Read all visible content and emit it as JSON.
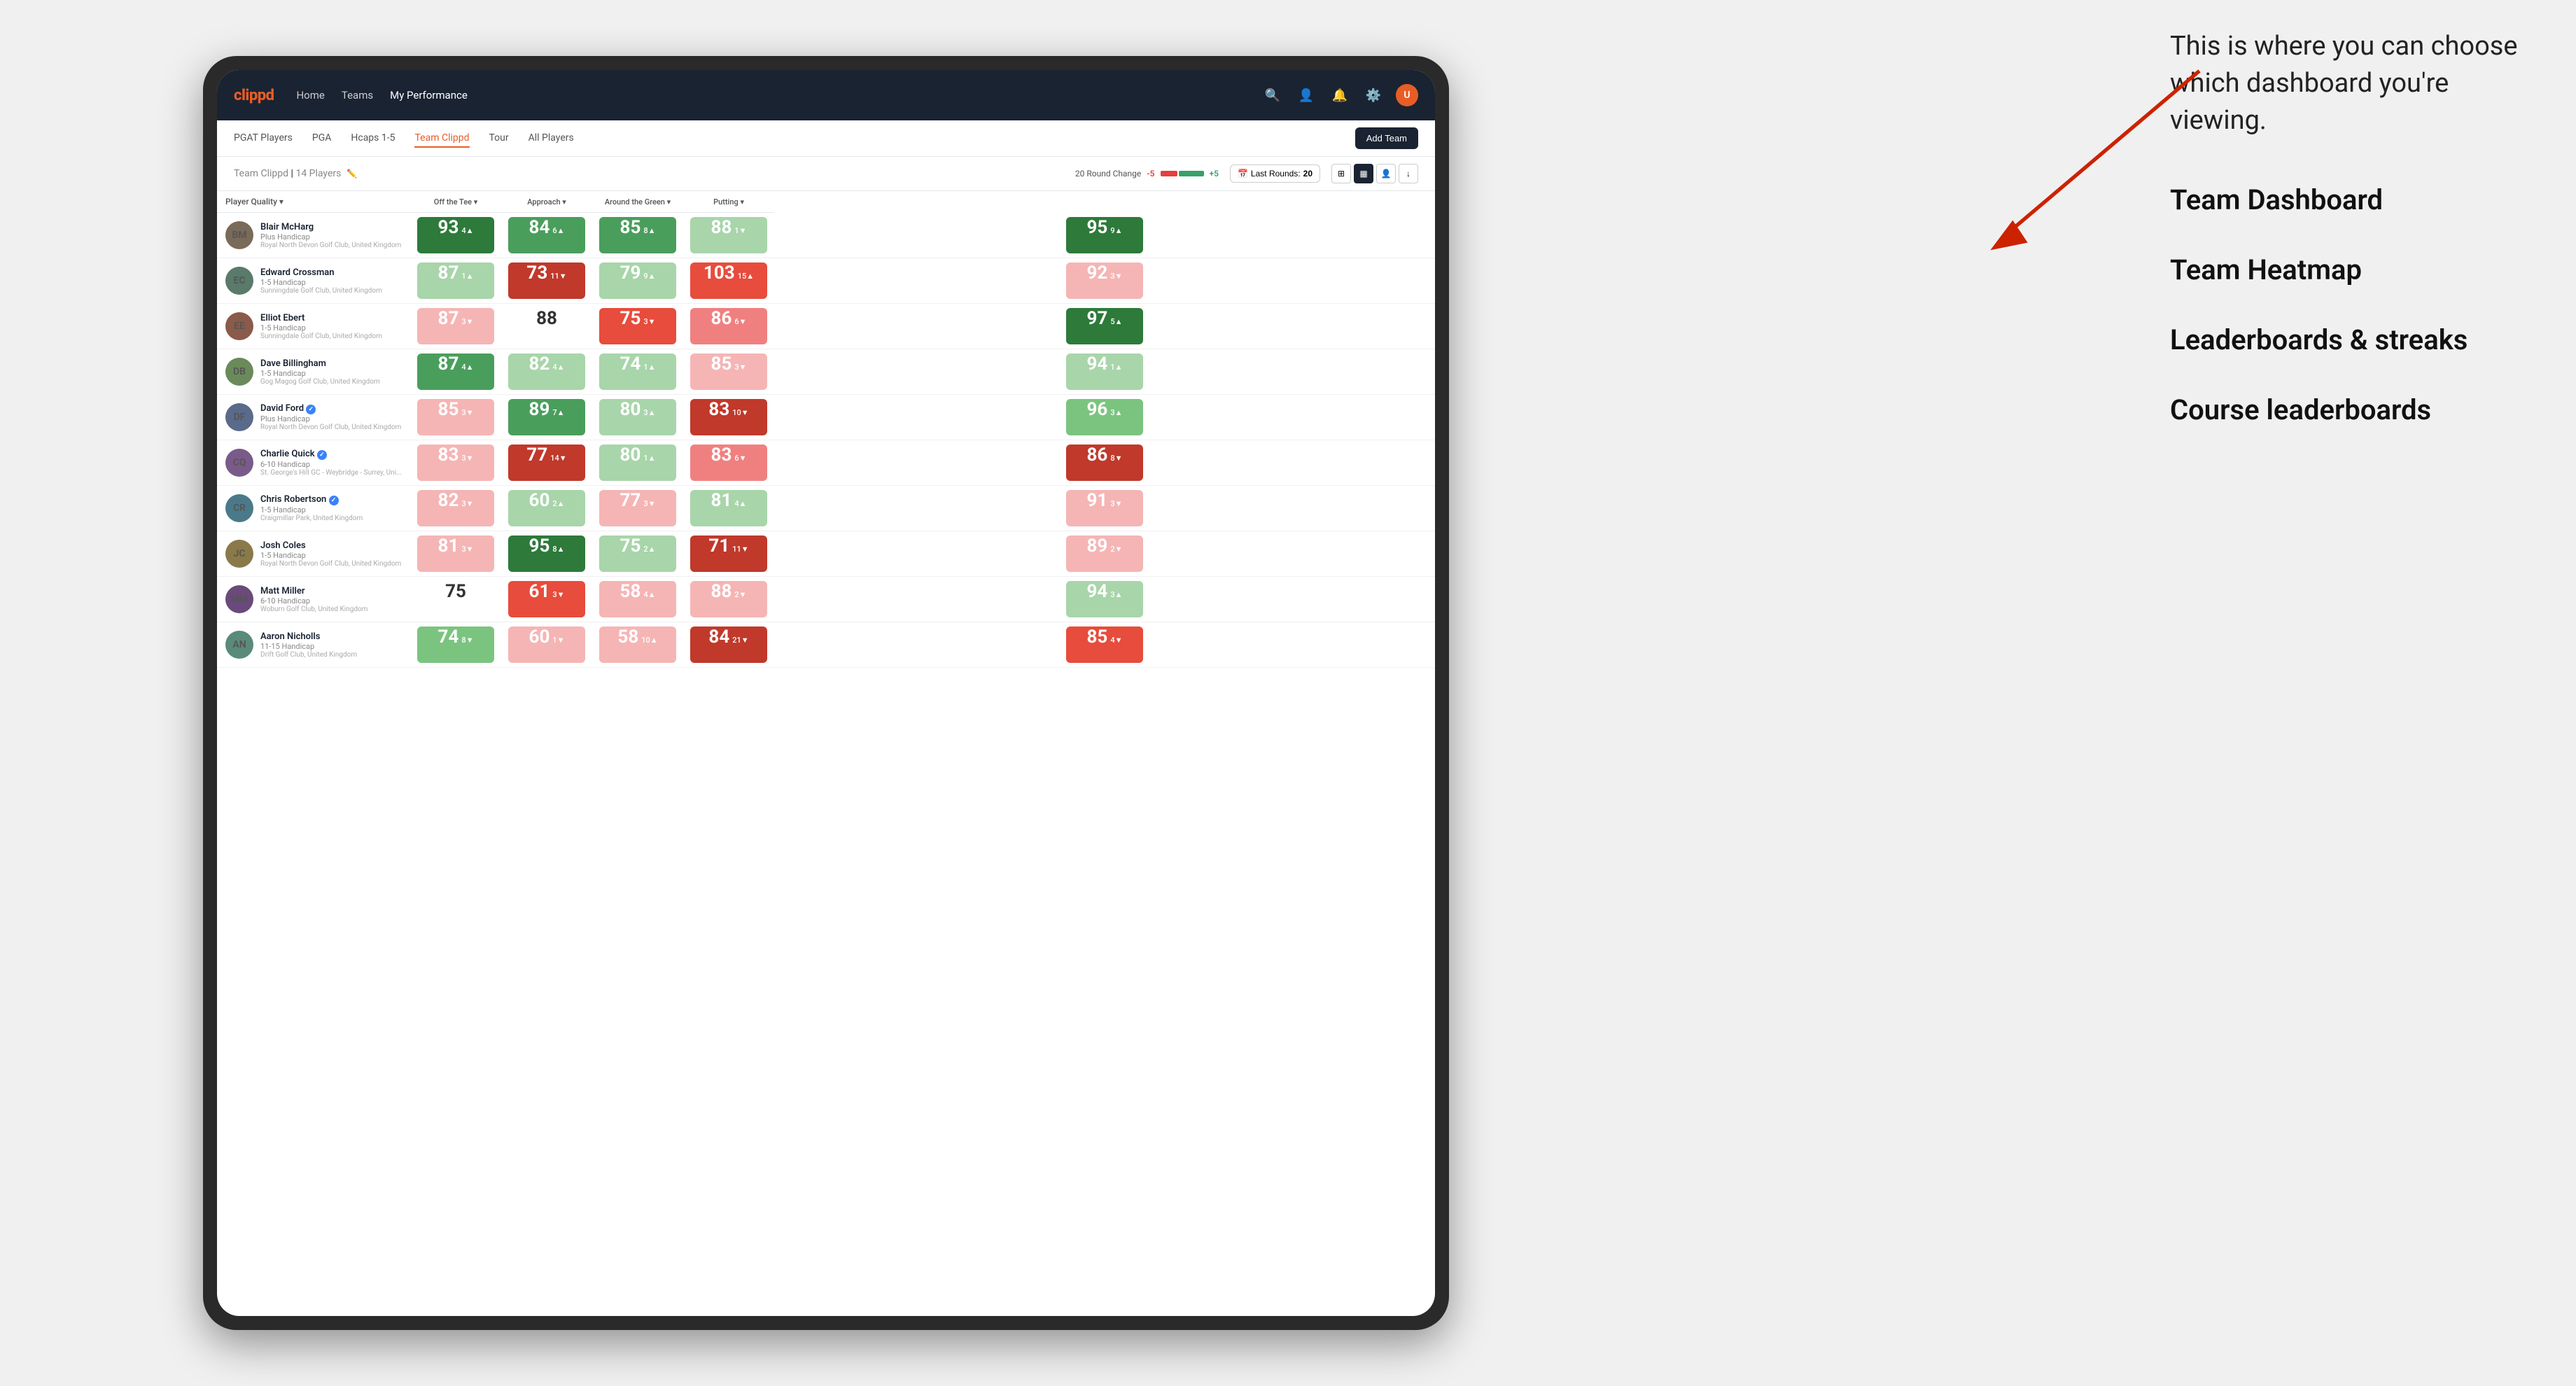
{
  "annotation": {
    "intro_text": "This is where you can choose which dashboard you're viewing.",
    "items": [
      {
        "label": "Team Dashboard",
        "active": true
      },
      {
        "label": "Team Heatmap",
        "active": false
      },
      {
        "label": "Leaderboards & streaks",
        "active": false
      },
      {
        "label": "Course leaderboards",
        "active": false
      }
    ]
  },
  "nav": {
    "logo": "clippd",
    "links": [
      "Home",
      "Teams",
      "My Performance"
    ],
    "active_link": "My Performance",
    "icons": [
      "search",
      "person",
      "bell",
      "settings",
      "avatar"
    ]
  },
  "sub_nav": {
    "links": [
      "PGAT Players",
      "PGA",
      "Hcaps 1-5",
      "Team Clippd",
      "Tour",
      "All Players"
    ],
    "active_link": "Team Clippd",
    "add_button": "Add Team"
  },
  "team_header": {
    "title": "Team Clippd",
    "count": "14 Players",
    "round_change_label": "20 Round Change",
    "minus": "-5",
    "plus": "+5",
    "last_rounds_label": "Last Rounds:",
    "last_rounds_value": "20"
  },
  "table": {
    "columns": {
      "player": "Player Quality ▾",
      "off_tee": "Off the Tee ▾",
      "approach": "Approach ▾",
      "around_green": "Around the Green ▾",
      "putting": "Putting ▾"
    },
    "players": [
      {
        "name": "Blair McHarg",
        "handicap": "Plus Handicap",
        "club": "Royal North Devon Golf Club, United Kingdom",
        "avatar_initials": "BM",
        "avatar_bg": "#7a6a5a",
        "scores": {
          "quality": {
            "value": 93,
            "change": 4,
            "dir": "up",
            "color": "bg-green-dark"
          },
          "off_tee": {
            "value": 84,
            "change": 6,
            "dir": "up",
            "color": "bg-green-med"
          },
          "approach": {
            "value": 85,
            "change": 8,
            "dir": "up",
            "color": "bg-green-med"
          },
          "around": {
            "value": 88,
            "change": 1,
            "dir": "down",
            "color": "bg-green-pale"
          },
          "putting": {
            "value": 95,
            "change": 9,
            "dir": "up",
            "color": "bg-green-dark"
          }
        }
      },
      {
        "name": "Edward Crossman",
        "handicap": "1-5 Handicap",
        "club": "Sunningdale Golf Club, United Kingdom",
        "avatar_initials": "EC",
        "avatar_bg": "#5a7a6a",
        "scores": {
          "quality": {
            "value": 87,
            "change": 1,
            "dir": "up",
            "color": "bg-green-pale"
          },
          "off_tee": {
            "value": 73,
            "change": 11,
            "dir": "down",
            "color": "bg-red-dark"
          },
          "approach": {
            "value": 79,
            "change": 9,
            "dir": "up",
            "color": "bg-green-pale"
          },
          "around": {
            "value": 103,
            "change": 15,
            "dir": "up",
            "color": "bg-red-med"
          },
          "putting": {
            "value": 92,
            "change": 3,
            "dir": "down",
            "color": "bg-red-pale"
          }
        }
      },
      {
        "name": "Elliot Ebert",
        "handicap": "1-5 Handicap",
        "club": "Sunningdale Golf Club, United Kingdom",
        "avatar_initials": "EE",
        "avatar_bg": "#8a5a4a",
        "scores": {
          "quality": {
            "value": 87,
            "change": 3,
            "dir": "down",
            "color": "bg-red-pale"
          },
          "off_tee": {
            "value": 88,
            "change": 0,
            "dir": null,
            "color": "bg-white"
          },
          "approach": {
            "value": 75,
            "change": 3,
            "dir": "down",
            "color": "bg-red-med"
          },
          "around": {
            "value": 86,
            "change": 6,
            "dir": "down",
            "color": "bg-red-light"
          },
          "putting": {
            "value": 97,
            "change": 5,
            "dir": "up",
            "color": "bg-green-dark"
          }
        }
      },
      {
        "name": "Dave Billingham",
        "handicap": "1-5 Handicap",
        "club": "Gog Magog Golf Club, United Kingdom",
        "avatar_initials": "DB",
        "avatar_bg": "#6a8a5a",
        "scores": {
          "quality": {
            "value": 87,
            "change": 4,
            "dir": "up",
            "color": "bg-green-med"
          },
          "off_tee": {
            "value": 82,
            "change": 4,
            "dir": "up",
            "color": "bg-green-pale"
          },
          "approach": {
            "value": 74,
            "change": 1,
            "dir": "up",
            "color": "bg-green-pale"
          },
          "around": {
            "value": 85,
            "change": 3,
            "dir": "down",
            "color": "bg-red-pale"
          },
          "putting": {
            "value": 94,
            "change": 1,
            "dir": "up",
            "color": "bg-green-pale"
          }
        }
      },
      {
        "name": "David Ford",
        "handicap": "Plus Handicap",
        "club": "Royal North Devon Golf Club, United Kingdom",
        "avatar_initials": "DF",
        "avatar_bg": "#5a6a8a",
        "verified": true,
        "scores": {
          "quality": {
            "value": 85,
            "change": 3,
            "dir": "down",
            "color": "bg-red-pale"
          },
          "off_tee": {
            "value": 89,
            "change": 7,
            "dir": "up",
            "color": "bg-green-med"
          },
          "approach": {
            "value": 80,
            "change": 3,
            "dir": "up",
            "color": "bg-green-pale"
          },
          "around": {
            "value": 83,
            "change": 10,
            "dir": "down",
            "color": "bg-red-dark"
          },
          "putting": {
            "value": 96,
            "change": 3,
            "dir": "up",
            "color": "bg-green-light"
          }
        }
      },
      {
        "name": "Charlie Quick",
        "handicap": "6-10 Handicap",
        "club": "St. George's Hill GC - Weybridge - Surrey, Uni...",
        "avatar_initials": "CQ",
        "avatar_bg": "#7a5a8a",
        "verified": true,
        "scores": {
          "quality": {
            "value": 83,
            "change": 3,
            "dir": "down",
            "color": "bg-red-pale"
          },
          "off_tee": {
            "value": 77,
            "change": 14,
            "dir": "down",
            "color": "bg-red-dark"
          },
          "approach": {
            "value": 80,
            "change": 1,
            "dir": "up",
            "color": "bg-green-pale"
          },
          "around": {
            "value": 83,
            "change": 6,
            "dir": "down",
            "color": "bg-red-light"
          },
          "putting": {
            "value": 86,
            "change": 8,
            "dir": "down",
            "color": "bg-red-dark"
          }
        }
      },
      {
        "name": "Chris Robertson",
        "handicap": "1-5 Handicap",
        "club": "Craigmillar Park, United Kingdom",
        "avatar_initials": "CR",
        "avatar_bg": "#4a7a8a",
        "verified": true,
        "scores": {
          "quality": {
            "value": 82,
            "change": 3,
            "dir": "down",
            "color": "bg-red-pale"
          },
          "off_tee": {
            "value": 60,
            "change": 2,
            "dir": "up",
            "color": "bg-green-pale"
          },
          "approach": {
            "value": 77,
            "change": 3,
            "dir": "down",
            "color": "bg-red-pale"
          },
          "around": {
            "value": 81,
            "change": 4,
            "dir": "up",
            "color": "bg-green-pale"
          },
          "putting": {
            "value": 91,
            "change": 3,
            "dir": "down",
            "color": "bg-red-pale"
          }
        }
      },
      {
        "name": "Josh Coles",
        "handicap": "1-5 Handicap",
        "club": "Royal North Devon Golf Club, United Kingdom",
        "avatar_initials": "JC",
        "avatar_bg": "#8a7a4a",
        "scores": {
          "quality": {
            "value": 81,
            "change": 3,
            "dir": "down",
            "color": "bg-red-pale"
          },
          "off_tee": {
            "value": 95,
            "change": 8,
            "dir": "up",
            "color": "bg-green-dark"
          },
          "approach": {
            "value": 75,
            "change": 2,
            "dir": "up",
            "color": "bg-green-pale"
          },
          "around": {
            "value": 71,
            "change": 11,
            "dir": "down",
            "color": "bg-red-dark"
          },
          "putting": {
            "value": 89,
            "change": 2,
            "dir": "down",
            "color": "bg-red-pale"
          }
        }
      },
      {
        "name": "Matt Miller",
        "handicap": "6-10 Handicap",
        "club": "Woburn Golf Club, United Kingdom",
        "avatar_initials": "MM",
        "avatar_bg": "#6a4a7a",
        "scores": {
          "quality": {
            "value": 75,
            "change": 0,
            "dir": null,
            "color": "bg-white"
          },
          "off_tee": {
            "value": 61,
            "change": 3,
            "dir": "down",
            "color": "bg-red-med"
          },
          "approach": {
            "value": 58,
            "change": 4,
            "dir": "up",
            "color": "bg-red-pale"
          },
          "around": {
            "value": 88,
            "change": 2,
            "dir": "down",
            "color": "bg-red-pale"
          },
          "putting": {
            "value": 94,
            "change": 3,
            "dir": "up",
            "color": "bg-green-pale"
          }
        }
      },
      {
        "name": "Aaron Nicholls",
        "handicap": "11-15 Handicap",
        "club": "Drift Golf Club, United Kingdom",
        "avatar_initials": "AN",
        "avatar_bg": "#5a8a7a",
        "scores": {
          "quality": {
            "value": 74,
            "change": 8,
            "dir": "down",
            "color": "bg-green-light"
          },
          "off_tee": {
            "value": 60,
            "change": 1,
            "dir": "down",
            "color": "bg-red-pale"
          },
          "approach": {
            "value": 58,
            "change": 10,
            "dir": "up",
            "color": "bg-red-pale"
          },
          "around": {
            "value": 84,
            "change": 21,
            "dir": "down",
            "color": "bg-red-dark"
          },
          "putting": {
            "value": 85,
            "change": 4,
            "dir": "down",
            "color": "bg-red-med"
          }
        }
      }
    ]
  }
}
